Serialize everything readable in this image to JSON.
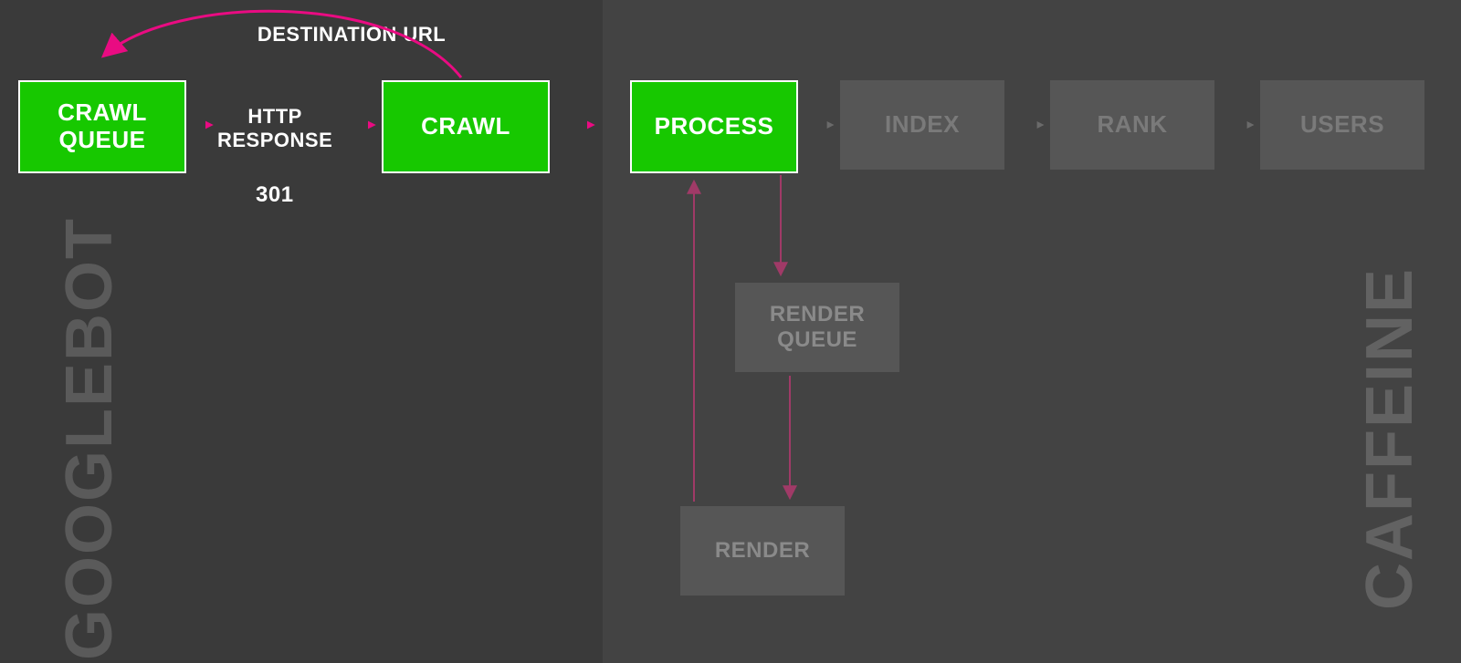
{
  "sections": {
    "left_label": "GOOGLEBOT",
    "right_label": "CAFFEINE"
  },
  "edge_labels": {
    "destination_url": "DESTINATION URL",
    "http_response": "HTTP\nRESPONSE",
    "http_code": "301"
  },
  "nodes": {
    "crawl_queue": "CRAWL QUEUE",
    "crawl": "CRAWL",
    "process": "PROCESS",
    "index": "INDEX",
    "rank": "RANK",
    "users": "USERS",
    "render_queue": "RENDER QUEUE",
    "render": "RENDER"
  },
  "colors": {
    "active_fill": "#17c800",
    "muted_fill": "#565656",
    "muted_text": "#7a7a7a",
    "accent": "#e90b82",
    "accent_dim": "#a03a67",
    "bg_left": "#3a3a3a",
    "bg_right": "#434343"
  }
}
